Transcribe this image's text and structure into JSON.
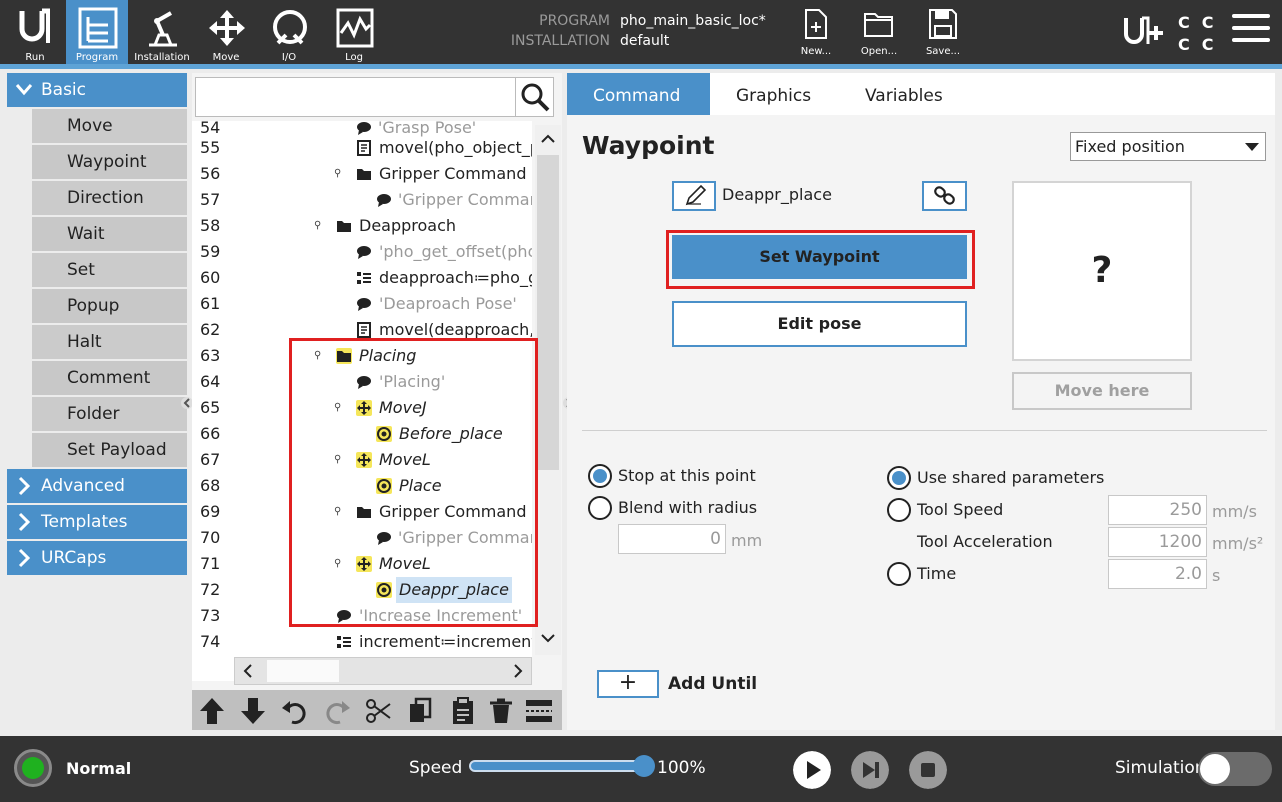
{
  "nav": {
    "items": [
      {
        "label": "Run",
        "icon": "ur-logo-icon"
      },
      {
        "label": "Program",
        "icon": "program-icon",
        "active": true
      },
      {
        "label": "Installation",
        "icon": "robot-arm-icon"
      },
      {
        "label": "Move",
        "icon": "move-arrows-icon"
      },
      {
        "label": "I/O",
        "icon": "io-icon"
      },
      {
        "label": "Log",
        "icon": "log-icon"
      }
    ]
  },
  "program_meta": {
    "program_key": "PROGRAM",
    "program_value": "pho_main_basic_loc*",
    "installation_key": "INSTALLATION",
    "installation_value": "default"
  },
  "file_actions": {
    "new": "New...",
    "open": "Open...",
    "save": "Save..."
  },
  "cc_labels": [
    "C",
    "C",
    "C",
    "C"
  ],
  "sidebar": {
    "basic_label": "Basic",
    "basic_items": [
      "Move",
      "Waypoint",
      "Direction",
      "Wait",
      "Set",
      "Popup",
      "Halt",
      "Comment",
      "Folder",
      "Set Payload"
    ],
    "advanced_label": "Advanced",
    "templates_label": "Templates",
    "urcaps_label": "URCaps"
  },
  "tree": {
    "partial_top": {
      "line": "54",
      "text": "'Grasp Pose'"
    },
    "rows": [
      {
        "line": "55",
        "text": "movel(pho_object_p"
      },
      {
        "line": "56",
        "text": "Gripper Command"
      },
      {
        "line": "57",
        "text": "'Gripper Comman"
      },
      {
        "line": "58",
        "text": "Deapproach"
      },
      {
        "line": "59",
        "text": "'pho_get_offset(pho"
      },
      {
        "line": "60",
        "text": "deapproach≔pho_g"
      },
      {
        "line": "61",
        "text": "'Deaproach Pose'"
      },
      {
        "line": "62",
        "text": "movel(deapproach,a"
      },
      {
        "line": "63",
        "text": "Placing"
      },
      {
        "line": "64",
        "text": "'Placing'"
      },
      {
        "line": "65",
        "text": "MoveJ"
      },
      {
        "line": "66",
        "text": "Before_place"
      },
      {
        "line": "67",
        "text": "MoveL"
      },
      {
        "line": "68",
        "text": "Place"
      },
      {
        "line": "69",
        "text": "Gripper Command"
      },
      {
        "line": "70",
        "text": "'Gripper Comman"
      },
      {
        "line": "71",
        "text": "MoveL"
      },
      {
        "line": "72",
        "text": "Deappr_place"
      },
      {
        "line": "73",
        "text": "'Increase Increment'"
      },
      {
        "line": "74",
        "text": "increment≔increment"
      }
    ]
  },
  "tabs": {
    "command": "Command",
    "graphics": "Graphics",
    "variables": "Variables"
  },
  "waypoint": {
    "title": "Waypoint",
    "position_type": "Fixed position",
    "name": "Deappr_place",
    "set_label": "Set Waypoint",
    "edit_label": "Edit pose",
    "preview_symbol": "?",
    "move_here_label": "Move here"
  },
  "motion": {
    "stop_label": "Stop at this point",
    "blend_label": "Blend with radius",
    "blend_value": "0",
    "blend_unit": "mm",
    "shared_label": "Use shared parameters",
    "speed_label": "Tool Speed",
    "speed_value": "250",
    "speed_unit": "mm/s",
    "accel_label": "Tool Acceleration",
    "accel_value": "1200",
    "accel_unit": "mm/s²",
    "time_label": "Time",
    "time_value": "2.0",
    "time_unit": "s",
    "add_symbol": "+",
    "add_until_label": "Add Until"
  },
  "footer": {
    "status": "Normal",
    "speed_label": "Speed",
    "speed_value": "100%",
    "speed_fraction": 1.0,
    "simulation_label": "Simulation",
    "status_color": "#1fb11f"
  },
  "colors": {
    "accent": "#4a90c9",
    "topbar": "#333333",
    "highlight_box": "#e02020",
    "node_highlight": "#f5e65a"
  }
}
